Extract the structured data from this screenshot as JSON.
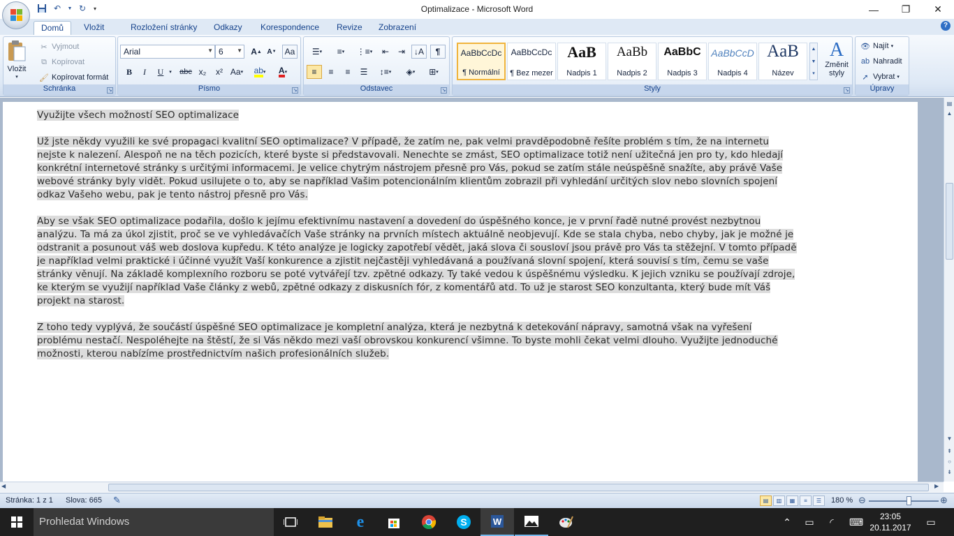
{
  "window": {
    "title": "Optimalizace - Microsoft Word",
    "controls": [
      "minimize-icon",
      "restore-icon",
      "close-icon"
    ]
  },
  "ribbon_tabs": [
    "Domů",
    "Vložit",
    "Rozložení stránky",
    "Odkazy",
    "Korespondence",
    "Revize",
    "Zobrazení"
  ],
  "active_tab": "Domů",
  "clipboard": {
    "label": "Schránka",
    "paste": "Vložit",
    "cut": "Vyjmout",
    "copy": "Kopírovat",
    "format_painter": "Kopírovat formát"
  },
  "font": {
    "label": "Písmo",
    "family": "Arial",
    "size": "6",
    "bold": "B",
    "italic": "I",
    "underline": "U",
    "strike": "abc",
    "sub": "x₂",
    "sup": "x²",
    "case": "Aa",
    "grow": "A",
    "shrink": "A"
  },
  "paragraph": {
    "label": "Odstavec"
  },
  "styles": {
    "label": "Styly",
    "items": [
      {
        "sample": "AaBbCcDc",
        "name": "¶ Normální"
      },
      {
        "sample": "AaBbCcDc",
        "name": "¶ Bez mezer"
      },
      {
        "sample": "AaB",
        "name": "Nadpis 1"
      },
      {
        "sample": "AaBb",
        "name": "Nadpis 2"
      },
      {
        "sample": "AaBbC",
        "name": "Nadpis 3"
      },
      {
        "sample": "AaBbCcD",
        "name": "Nadpis 4"
      },
      {
        "sample": "AaB",
        "name": "Název"
      }
    ],
    "change_styles": "Změnit styly"
  },
  "editing": {
    "label": "Úpravy",
    "find": "Najít",
    "replace": "Nahradit",
    "select": "Vybrat"
  },
  "document": {
    "paragraphs": [
      "Využijte všech možností SEO optimalizace",
      "Už jste někdy využili ke své propagaci kvalitní SEO optimalizace? V případě, že zatím ne, pak velmi pravděpodobně řešíte problém s tím, že na internetu nejste k nalezení. Alespoň ne na těch pozicích, které byste si představovali. Nenechte se zmást, SEO optimalizace totiž není užitečná jen pro ty, kdo hledají konkrétní internetové stránky s určitými informacemi. Je velice chytrým nástrojem přesně pro Vás, pokud se zatím stále neúspěšně snažíte, aby právě Vaše webové stránky byly vidět. Pokud usilujete o to, aby se například Vašim potencionálním klientům zobrazil při vyhledání určitých slov nebo slovních spojení odkaz Vašeho webu, pak je tento nástroj přesně pro Vás.",
      "Aby se však SEO optimalizace podařila, došlo k jejímu efektivnímu nastavení a dovedení do úspěšného konce, je v první řadě nutné provést nezbytnou analýzu. Ta má za úkol zjistit, proč se ve vyhledávačích Vaše stránky na prvních místech aktuálně neobjevují. Kde se stala chyba, nebo chyby, jak je možné je odstranit a posunout váš web doslova kupředu. K této analýze je logicky zapotřebí vědět, jaká slova či sousloví jsou právě pro Vás ta stěžejní. V tomto případě je například velmi praktické i účinné využít Vaší konkurence a zjistit nejčastěji vyhledávaná a používaná slovní spojení, která souvisí s tím, čemu se vaše stránky věnují. Na základě komplexního rozboru se poté vytvářejí tzv. zpětné odkazy. Ty také vedou k úspěšnému výsledku. K jejich vzniku se používají zdroje, ke kterým se využijí například Vaše články z webů, zpětné odkazy z diskusních fór, z komentářů atd. To už je starost SEO konzultanta, který bude mít Váš projekt na starost.",
      "Z toho tedy vyplývá, že součástí úspěšné SEO optimalizace je kompletní analýza, která je nezbytná k detekování nápravy, samotná však na vyřešení problému nestačí. Nespoléhejte na štěstí, že si Vás někdo mezi vaší obrovskou konkurencí všimne. To byste mohli čekat velmi dlouho. Využijte jednoduché možnosti, kterou nabízíme prostřednictvím našich profesionálních služeb."
    ]
  },
  "statusbar": {
    "page": "Stránka: 1 z 1",
    "words": "Slova: 665",
    "zoom": "180 %"
  },
  "taskbar": {
    "search_placeholder": "Prohledat Windows",
    "time": "23:05",
    "date": "20.11.2017"
  },
  "colors": {
    "ribbon_bg": "#dde8f5",
    "accent": "#15428b",
    "taskbar": "#1f1f1f",
    "selection_highlight": "#dcdcdc"
  }
}
